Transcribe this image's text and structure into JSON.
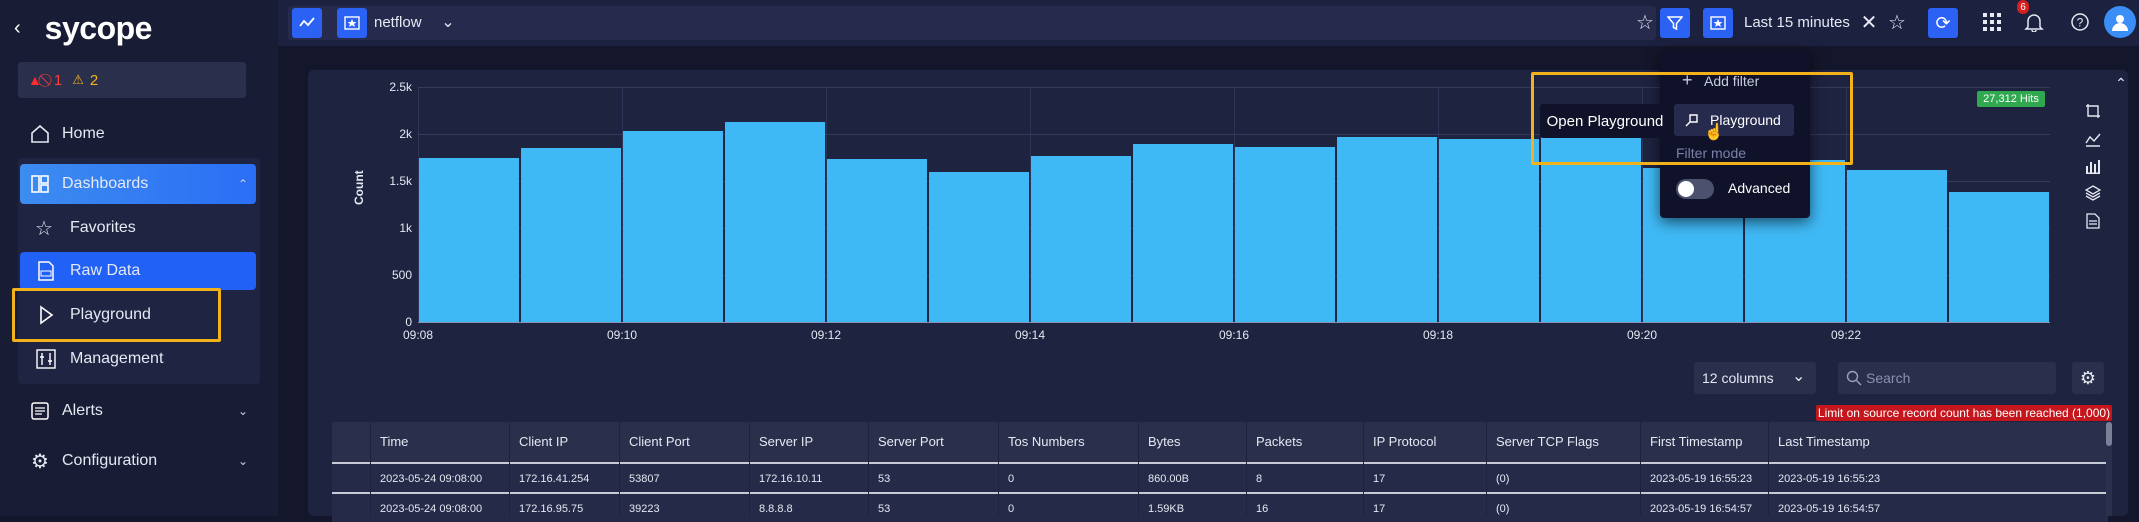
{
  "brand": {
    "logo_text": "sycope"
  },
  "alerts": {
    "critical_count": "1",
    "warning_count": "2"
  },
  "sidebar": {
    "items": [
      {
        "label": "Home"
      },
      {
        "label": "Dashboards"
      },
      {
        "label": "Favorites"
      },
      {
        "label": "Raw Data"
      },
      {
        "label": "Playground"
      },
      {
        "label": "Management"
      },
      {
        "label": "Alerts"
      },
      {
        "label": "Configuration"
      }
    ]
  },
  "topbar": {
    "dashboard_name": "netflow",
    "time_range": "Last 15 minutes",
    "notification_count": "6"
  },
  "filter_popup": {
    "add_filter": "Add filter",
    "playground": "Playground",
    "filter_mode": "Filter mode",
    "advanced": "Advanced",
    "tooltip": "Open Playground",
    "advanced_enabled": false
  },
  "chart_data": {
    "type": "bar",
    "ylabel": "Count",
    "ylim": [
      0,
      2500
    ],
    "yticks": [
      "0",
      "500",
      "1k",
      "1.5k",
      "2k",
      "2.5k"
    ],
    "x_ticks": [
      "09:08",
      "09:10",
      "09:12",
      "09:14",
      "09:16",
      "09:18",
      "09:20",
      "09:22"
    ],
    "categories": [
      "09:08",
      "09:09",
      "09:10",
      "09:11",
      "09:12",
      "09:13",
      "09:14",
      "09:15",
      "09:16",
      "09:17",
      "09:18",
      "09:19",
      "09:20",
      "09:21",
      "09:22"
    ],
    "values": [
      1740,
      1850,
      2030,
      2130,
      1730,
      1600,
      1770,
      1890,
      1860,
      1970,
      1950,
      2000,
      1640,
      1720,
      1620,
      1380
    ],
    "hits_label": "27,312 Hits"
  },
  "table": {
    "columns_select": "12 columns",
    "search_placeholder": "Search",
    "limit_message": "Limit on source record count has been reached (1,000)",
    "headers": [
      "Time",
      "Client IP",
      "Client Port",
      "Server IP",
      "Server Port",
      "Tos Numbers",
      "Bytes",
      "Packets",
      "IP Protocol",
      "Server TCP Flags",
      "First Timestamp",
      "Last Timestamp"
    ],
    "rows": [
      [
        "2023-05-24 09:08:00",
        "172.16.41.254",
        "53807",
        "172.16.10.11",
        "53",
        "0",
        "860.00B",
        "8",
        "17",
        "(0)",
        "2023-05-19 16:55:23",
        "2023-05-19 16:55:23"
      ],
      [
        "2023-05-24 09:08:00",
        "172.16.95.75",
        "39223",
        "8.8.8.8",
        "53",
        "0",
        "1.59KB",
        "16",
        "17",
        "(0)",
        "2023-05-19 16:54:57",
        "2023-05-19 16:54:57"
      ]
    ]
  }
}
